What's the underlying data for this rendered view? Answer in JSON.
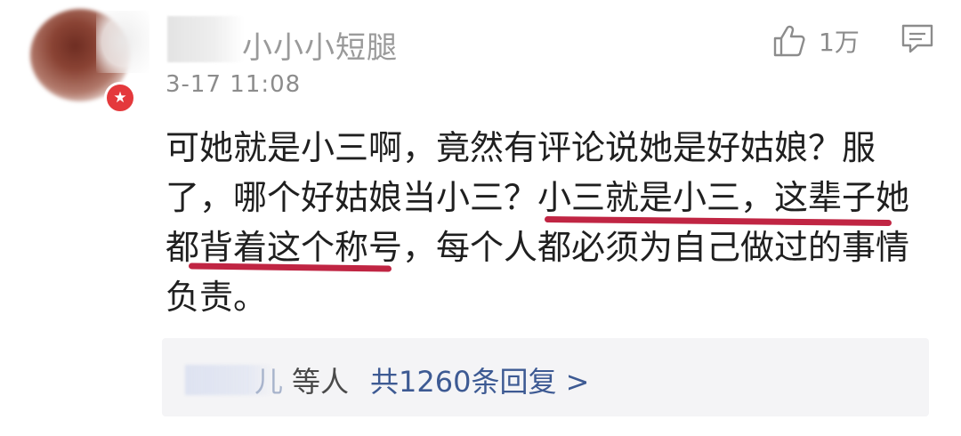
{
  "comment": {
    "username": "小小小短腿",
    "timestamp": "3-17 11:08",
    "badge_icon": "vip-star-icon",
    "accent_color": "#c02543",
    "likes": "1万",
    "body_lines": [
      "可她就是小三啊，竟然有评论说她是好姑娘？服",
      "了，哪个好姑娘当小三？小三就是小三，这辈子她",
      "都背着这个称号，每个人都必须为自己做过的事情",
      "负责。"
    ]
  },
  "replies": {
    "partial_name": "儿",
    "suffix": "等人",
    "count_text": "共1260条回复 >",
    "link_color": "#3d5a93"
  }
}
